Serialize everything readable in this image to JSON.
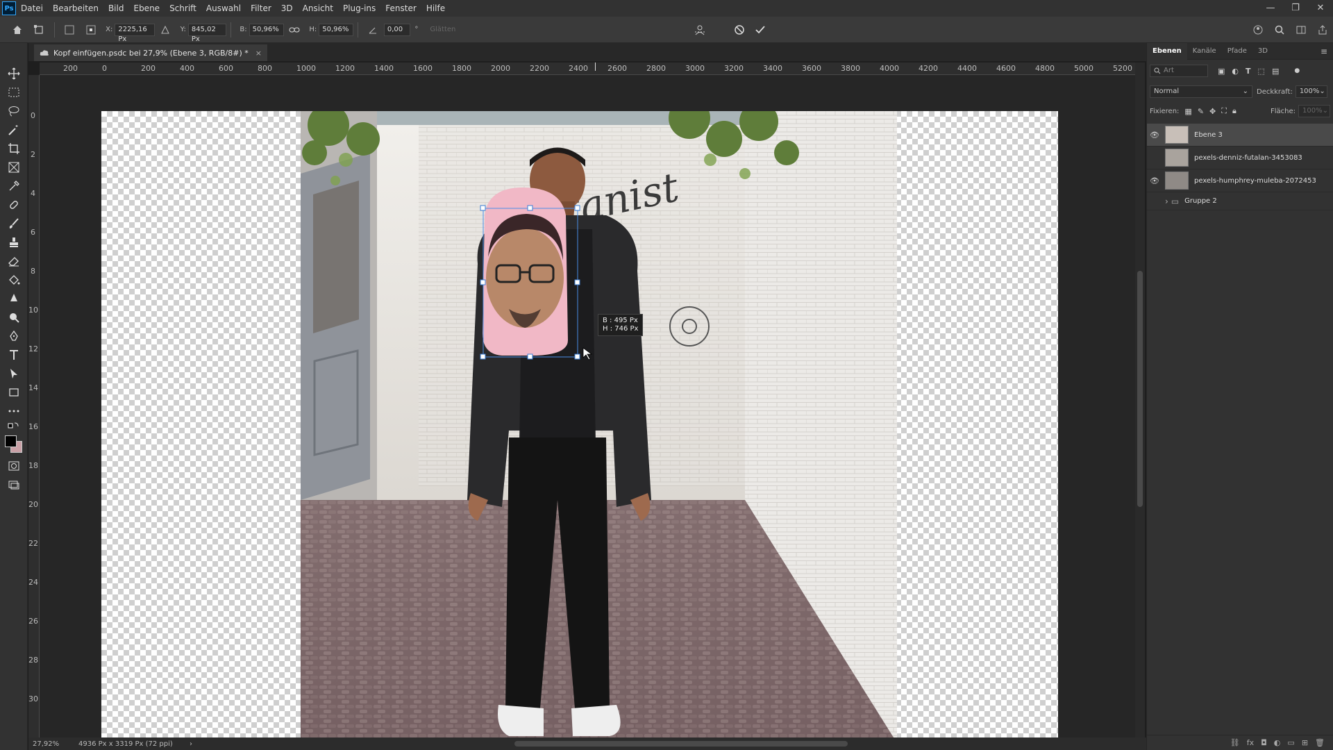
{
  "app": {
    "logo": "Ps"
  },
  "menu": [
    "Datei",
    "Bearbeiten",
    "Bild",
    "Ebene",
    "Schrift",
    "Auswahl",
    "Filter",
    "3D",
    "Ansicht",
    "Plug-ins",
    "Fenster",
    "Hilfe"
  ],
  "options": {
    "x_label": "X:",
    "x_value": "2225,16 Px",
    "y_label": "Y:",
    "y_value": "845,02 Px",
    "w_label": "B:",
    "w_value": "50,96%",
    "h_label": "H:",
    "h_value": "50,96%",
    "angle_value": "0,00",
    "degree": "°",
    "smooth_label": "Glätten"
  },
  "document": {
    "tab_title": "Kopf einfügen.psdc bei 27,9% (Ebene 3, RGB/8#) *",
    "close": "×"
  },
  "ruler": {
    "h_ticks": [
      "200",
      "0",
      "200",
      "400",
      "600",
      "800",
      "1000",
      "1200",
      "1400",
      "1600",
      "1800",
      "2000",
      "2200",
      "2400",
      "2600",
      "2800",
      "3000",
      "3200",
      "3400",
      "3600",
      "3800",
      "4000",
      "4200",
      "4400",
      "4600",
      "4800",
      "5000",
      "5200"
    ],
    "v_ticks": [
      "0",
      "2",
      "4",
      "6",
      "8",
      "10",
      "12",
      "14",
      "16",
      "18",
      "20",
      "22",
      "24",
      "26",
      "28",
      "30"
    ]
  },
  "transform_info": {
    "w": "B : 495 Px",
    "h": "H : 746 Px"
  },
  "status": {
    "zoom": "27,92%",
    "doc_size": "4936 Px x 3319 Px (72 ppi)",
    "arrow": "›"
  },
  "panel": {
    "tabs": [
      "Ebenen",
      "Kanäle",
      "Pfade",
      "3D"
    ],
    "search_placeholder": "Art",
    "blend_mode": "Normal",
    "opacity_label": "Deckkraft:",
    "opacity_value": "100%",
    "lock_label": "Fixieren:",
    "fill_label": "Fläche:",
    "fill_value": "100%",
    "layers": [
      {
        "name": "Ebene 3",
        "visible": true,
        "selected": true
      },
      {
        "name": "pexels-denniz-futalan-3453083",
        "visible": false,
        "selected": false
      },
      {
        "name": "pexels-humphrey-muleba-2072453",
        "visible": true,
        "selected": false
      },
      {
        "name": "Gruppe 2",
        "visible": false,
        "selected": false,
        "group": true
      }
    ]
  },
  "colors": {
    "accent": "#31a8ff",
    "selection": "#4a4a4a",
    "face_overlay": "#f1b8c6"
  }
}
